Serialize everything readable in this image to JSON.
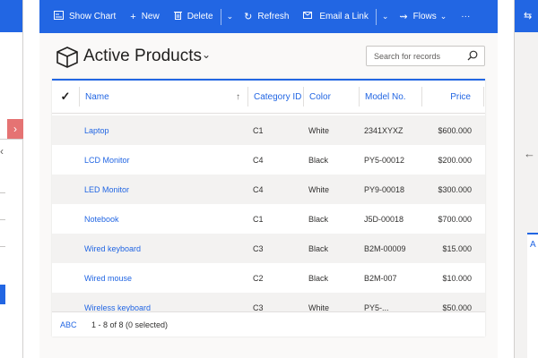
{
  "commandbar": {
    "show_chart": "Show Chart",
    "new": "New",
    "delete": "Delete",
    "refresh": "Refresh",
    "email_link": "Email a Link",
    "flows": "Flows",
    "more": "···"
  },
  "view": {
    "title": "Active Products"
  },
  "search": {
    "placeholder": "Search for records"
  },
  "grid": {
    "columns": {
      "name": "Name",
      "category": "Category ID",
      "color": "Color",
      "model": "Model No.",
      "price": "Price"
    },
    "rows": [
      {
        "name": "Laptop",
        "category": "C1",
        "color": "White",
        "model": "2341XYXZ",
        "price": "$600.000"
      },
      {
        "name": "LCD Monitor",
        "category": "C4",
        "color": "Black",
        "model": "PY5-00012",
        "price": "$200.000"
      },
      {
        "name": "LED Monitor",
        "category": "C4",
        "color": "White",
        "model": "PY9-00018",
        "price": "$300.000"
      },
      {
        "name": "Notebook",
        "category": "C1",
        "color": "Black",
        "model": "J5D-00018",
        "price": "$700.000"
      },
      {
        "name": "Wired keyboard",
        "category": "C3",
        "color": "Black",
        "model": "B2M-00009",
        "price": "$15.000"
      },
      {
        "name": "Wired mouse",
        "category": "C2",
        "color": "Black",
        "model": "B2M-007",
        "price": "$10.000"
      },
      {
        "name": "Wireless keyboard",
        "category": "C3",
        "color": "White",
        "model": "PY5-...",
        "price": "$50.000"
      }
    ],
    "footer": {
      "jump": "ABC",
      "count": "1 - 8 of 8 (0 selected)"
    }
  },
  "colors": {
    "accent": "#2266e3",
    "row_alt": "#f3f2f1"
  }
}
